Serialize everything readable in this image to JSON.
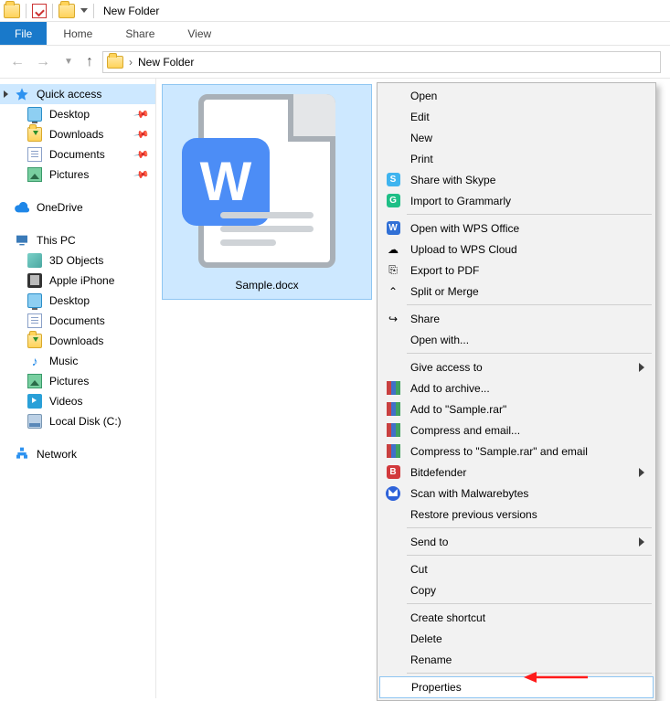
{
  "title": "New Folder",
  "ribbon": {
    "file": "File",
    "home": "Home",
    "share": "Share",
    "view": "View"
  },
  "breadcrumb": {
    "loc": "New Folder"
  },
  "sidebar": {
    "quick_access": "Quick access",
    "desktop": "Desktop",
    "downloads": "Downloads",
    "documents": "Documents",
    "pictures": "Pictures",
    "onedrive": "OneDrive",
    "this_pc": "This PC",
    "objects3d": "3D Objects",
    "iphone": "Apple iPhone",
    "desktop2": "Desktop",
    "documents2": "Documents",
    "downloads2": "Downloads",
    "music": "Music",
    "pictures2": "Pictures",
    "videos": "Videos",
    "localdisk": "Local Disk (C:)",
    "network": "Network"
  },
  "file": {
    "name": "Sample.docx"
  },
  "ctx": {
    "open": "Open",
    "edit": "Edit",
    "new": "New",
    "print": "Print",
    "skype": "Share with Skype",
    "grammarly": "Import to Grammarly",
    "wps_open": "Open with WPS Office",
    "wps_upload": "Upload to WPS Cloud",
    "export_pdf": "Export to PDF",
    "split_merge": "Split or Merge",
    "share": "Share",
    "open_with": "Open with...",
    "give_access": "Give access to",
    "add_archive": "Add to archive...",
    "add_sample_rar": "Add to \"Sample.rar\"",
    "compress_email": "Compress and email...",
    "compress_sample_email": "Compress to \"Sample.rar\" and email",
    "bitdefender": "Bitdefender",
    "malwarebytes": "Scan with Malwarebytes",
    "restore": "Restore previous versions",
    "send_to": "Send to",
    "cut": "Cut",
    "copy": "Copy",
    "create_shortcut": "Create shortcut",
    "delete": "Delete",
    "rename": "Rename",
    "properties": "Properties"
  }
}
